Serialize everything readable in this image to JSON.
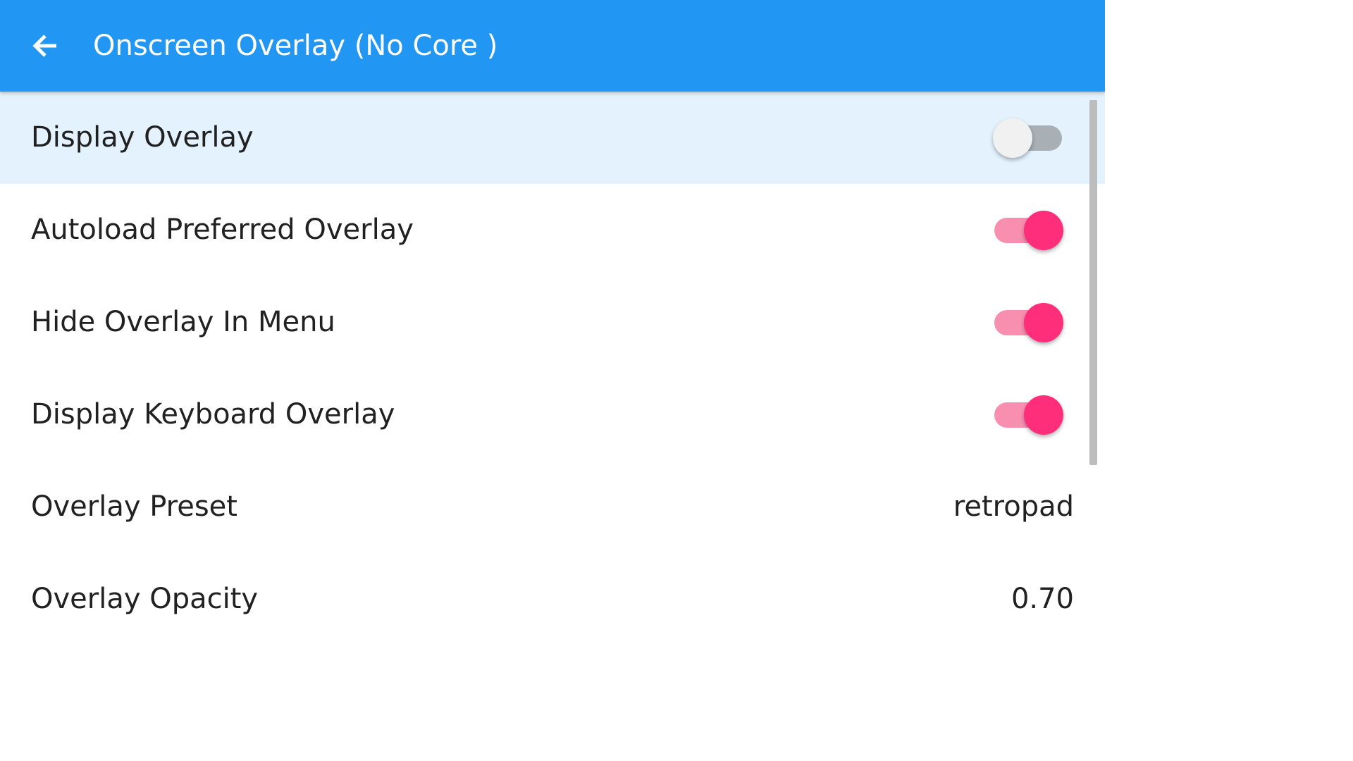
{
  "appbar": {
    "title": "Onscreen Overlay (No Core )",
    "back_icon": "arrow-back-icon",
    "color": "#2196F3"
  },
  "colors": {
    "selected_row": "#E3F2FD",
    "toggle_on": "#FF2E7A",
    "toggle_on_track": "#F88FB1",
    "toggle_off_track": "#A8AFB5"
  },
  "items": [
    {
      "label": "Display Overlay",
      "type": "toggle",
      "enabled": false
    },
    {
      "label": "Autoload Preferred Overlay",
      "type": "toggle",
      "enabled": true
    },
    {
      "label": "Hide Overlay In Menu",
      "type": "toggle",
      "enabled": true
    },
    {
      "label": "Display Keyboard Overlay",
      "type": "toggle",
      "enabled": true
    },
    {
      "label": "Overlay Preset",
      "type": "value",
      "value": "retropad"
    },
    {
      "label": "Overlay Opacity",
      "type": "value",
      "value": "0.70"
    }
  ]
}
